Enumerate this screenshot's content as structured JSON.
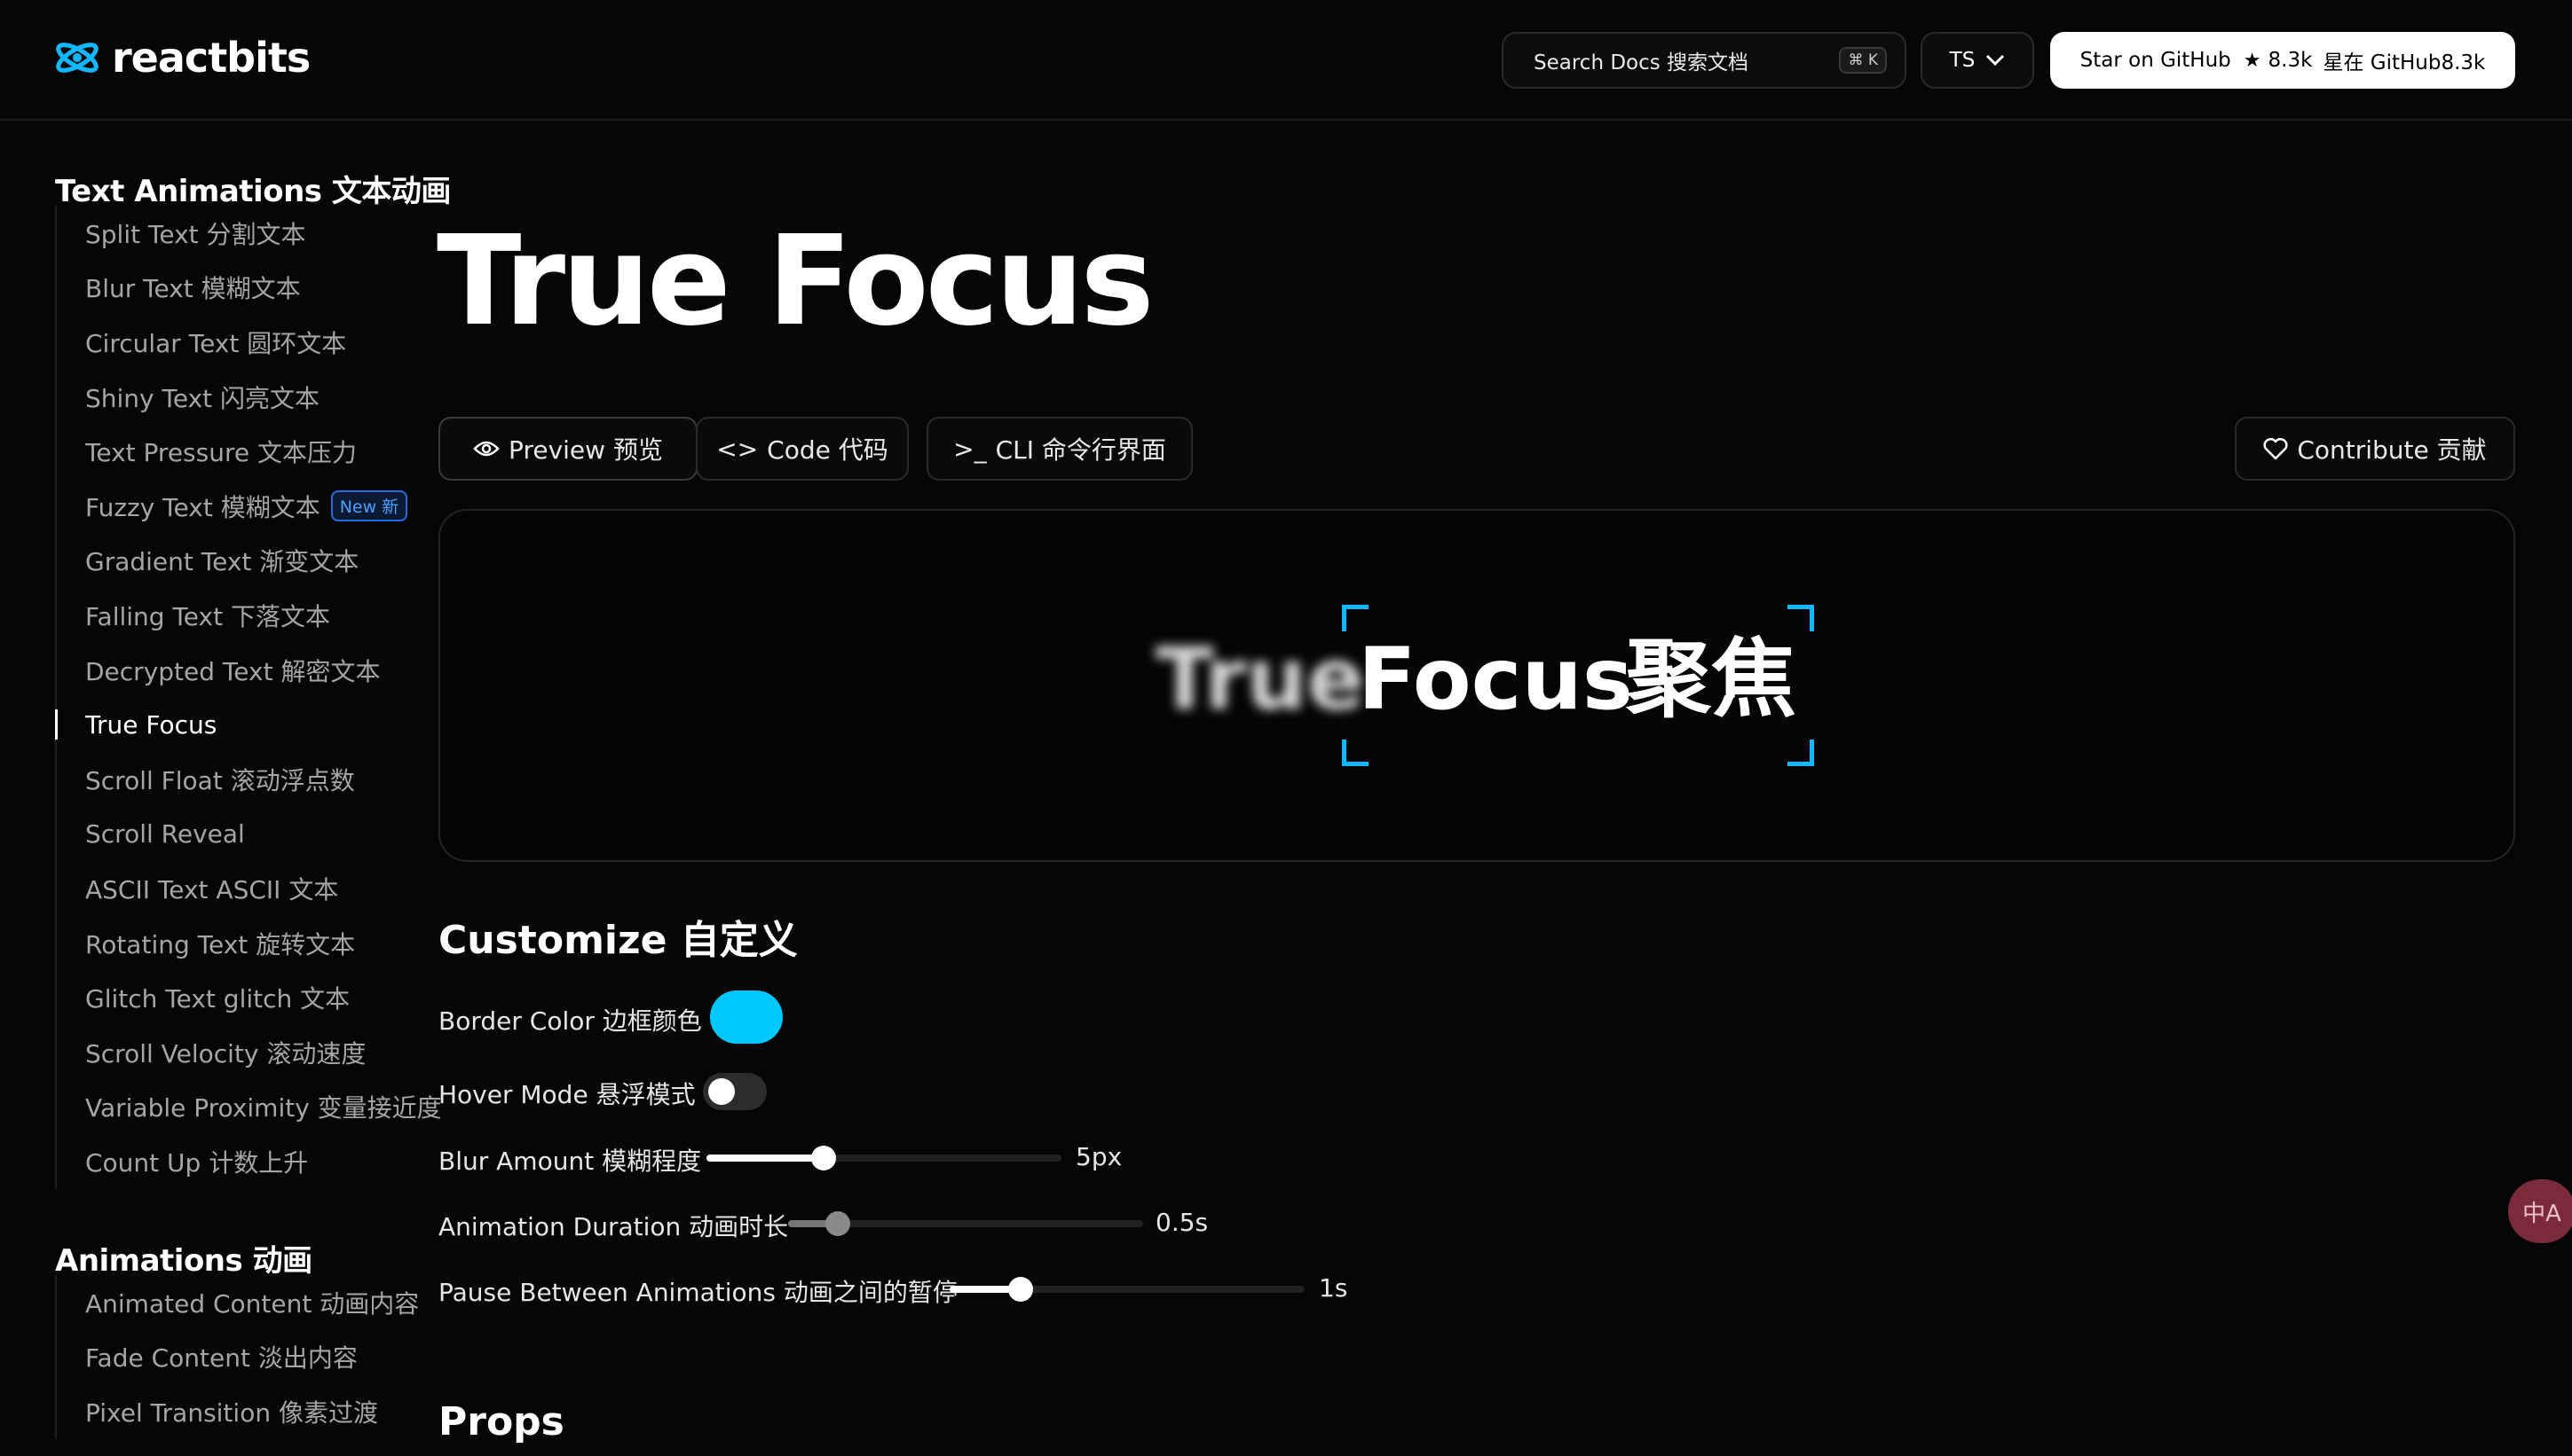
{
  "header": {
    "logo_text": "reactbits",
    "search_label": "Search Docs 搜索文档",
    "search_shortcut": "⌘ K",
    "lang_label": "TS",
    "github_label": "Star on GitHub",
    "github_stars": "8.3k",
    "github_extra": "星在 GitHub8.3k"
  },
  "sidebar": {
    "section1_title": "Text Animations 文本动画",
    "section1_items": [
      {
        "label": "Split Text 分割文本"
      },
      {
        "label": "Blur Text 模糊文本"
      },
      {
        "label": "Circular Text 圆环文本"
      },
      {
        "label": "Shiny Text 闪亮文本"
      },
      {
        "label": "Text Pressure 文本压力"
      },
      {
        "label": "Fuzzy Text 模糊文本",
        "badge": "New 新"
      },
      {
        "label": "Gradient Text 渐变文本"
      },
      {
        "label": "Falling Text 下落文本"
      },
      {
        "label": "Decrypted Text 解密文本"
      },
      {
        "label": "True Focus"
      },
      {
        "label": "Scroll Float 滚动浮点数"
      },
      {
        "label": "Scroll Reveal"
      },
      {
        "label": "ASCII Text ASCII 文本"
      },
      {
        "label": "Rotating Text 旋转文本"
      },
      {
        "label": "Glitch Text glitch 文本"
      },
      {
        "label": "Scroll Velocity 滚动速度"
      },
      {
        "label": "Variable Proximity 变量接近度"
      },
      {
        "label": "Count Up 计数上升"
      }
    ],
    "section2_title": "Animations 动画",
    "section2_items": [
      {
        "label": "Animated Content 动画内容"
      },
      {
        "label": "Fade Content 淡出内容"
      },
      {
        "label": "Pixel Transition 像素过渡"
      }
    ]
  },
  "main": {
    "title": "True Focus",
    "tabs": {
      "preview": "Preview 预览",
      "code": "Code 代码",
      "cli": "CLI 命令行界面",
      "contribute": "Contribute 贡献"
    },
    "demo": {
      "word1": "True",
      "word2": "Focus",
      "word3": "聚焦",
      "accent": "#12b8ff"
    },
    "customize": {
      "title": "Customize 自定义",
      "border_color_label": "Border Color 边框颜色",
      "border_color": "#00c8ff",
      "hover_mode_label": "Hover Mode 悬浮模式",
      "hover_mode_on": false,
      "blur_label": "Blur Amount 模糊程度",
      "blur_value": "5px",
      "blur_fraction": 0.33,
      "duration_label": "Animation Duration 动画时长",
      "duration_value": "0.5s",
      "duration_fraction": 0.14,
      "pause_label": "Pause Between Animations 动画之间的暂停",
      "pause_value": "1s",
      "pause_fraction": 0.2
    },
    "props_title": "Props"
  },
  "floating": {
    "icon": "translate-icon",
    "label": "中A"
  }
}
